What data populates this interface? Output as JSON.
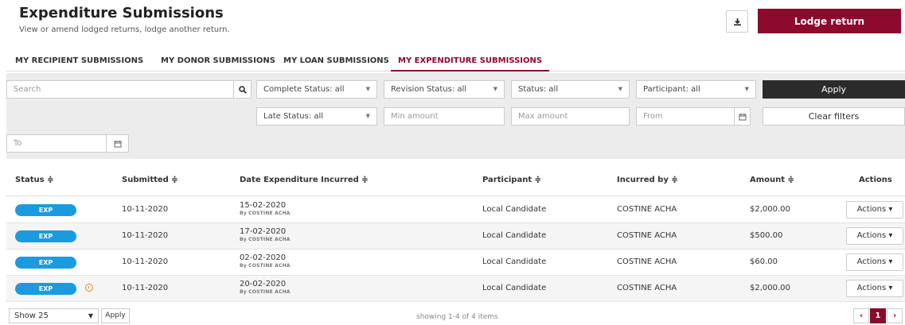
{
  "header": {
    "title": "Expenditure Submissions",
    "subtitle": "View or amend lodged returns, lodge another return.",
    "lodge_label": "Lodge return"
  },
  "tabs": [
    {
      "label": "MY RECIPIENT SUBMISSIONS",
      "active": false
    },
    {
      "label": "MY DONOR SUBMISSIONS",
      "active": false
    },
    {
      "label": "MY LOAN SUBMISSIONS",
      "active": false
    },
    {
      "label": "MY EXPENDITURE SUBMISSIONS",
      "active": true
    }
  ],
  "filters": {
    "search_placeholder": "Search",
    "complete_status": "Complete Status: all",
    "revision_status": "Revision Status: all",
    "status": "Status: all",
    "participant": "Participant: all",
    "apply": "Apply",
    "late_status": "Late Status: all",
    "min_amount": "Min amount",
    "max_amount": "Max amount",
    "from": "From",
    "clear": "Clear filters",
    "to": "To"
  },
  "columns": {
    "status": "Status ≑",
    "submitted": "Submitted ≑",
    "date_incurred": "Date Expenditure Incurred ≑",
    "participant": "Participant ≑",
    "incurred_by": "Incurred by ≑",
    "amount": "Amount ≑",
    "actions": "Actions"
  },
  "rows": [
    {
      "status": "EXP",
      "warning": false,
      "submitted": "10-11-2020",
      "date": "15-02-2020",
      "by": "By COSTINE ACHA",
      "participant": "Local Candidate",
      "incurred_by": "COSTINE ACHA",
      "amount": "$2,000.00",
      "actions": "Actions ▾"
    },
    {
      "status": "EXP",
      "warning": false,
      "submitted": "10-11-2020",
      "date": "17-02-2020",
      "by": "By COSTINE ACHA",
      "participant": "Local Candidate",
      "incurred_by": "COSTINE ACHA",
      "amount": "$500.00",
      "actions": "Actions ▾"
    },
    {
      "status": "EXP",
      "warning": false,
      "submitted": "10-11-2020",
      "date": "02-02-2020",
      "by": "By COSTINE ACHA",
      "participant": "Local Candidate",
      "incurred_by": "COSTINE ACHA",
      "amount": "$60.00",
      "actions": "Actions ▾"
    },
    {
      "status": "EXP",
      "warning": true,
      "submitted": "10-11-2020",
      "date": "20-02-2020",
      "by": "By COSTINE ACHA",
      "participant": "Local Candidate",
      "incurred_by": "COSTINE ACHA",
      "amount": "$2,000.00",
      "actions": "Actions ▾"
    }
  ],
  "footer": {
    "show": "Show 25",
    "apply": "Apply",
    "showing": "showing 1-4 of 4 items",
    "prev": "‹",
    "page": "1",
    "next": "›"
  },
  "colors": {
    "brand": "#8b0a2e",
    "badge": "#1a9be0",
    "warning": "#e68a1f"
  },
  "icons": [
    "download-icon",
    "search-icon",
    "calendar-icon",
    "warning-icon"
  ]
}
